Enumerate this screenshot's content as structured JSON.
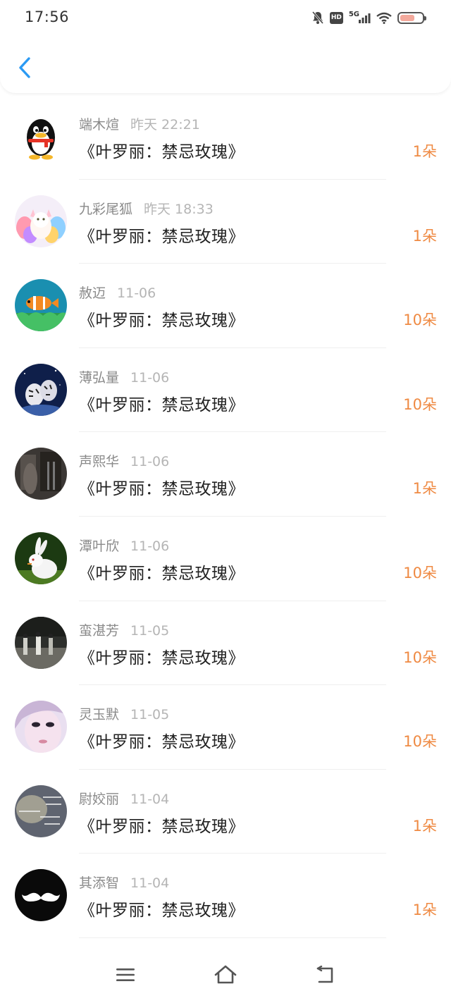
{
  "status_bar": {
    "time": "17:56",
    "network": "5G",
    "hd": "HD"
  },
  "header": {
    "back_icon": "chevron-left-icon",
    "accent_color": "#2b9af3"
  },
  "gifts": [
    {
      "name": "端木煊",
      "time": "昨天 22:21",
      "title": "《叶罗丽：禁忌玫瑰》",
      "amount": "1朵",
      "avatar": "qq-penguin"
    },
    {
      "name": "九彩尾狐",
      "time": "昨天 18:33",
      "title": "《叶罗丽：禁忌玫瑰》",
      "amount": "1朵",
      "avatar": "fox"
    },
    {
      "name": "赦迈",
      "time": "11-06",
      "title": "《叶罗丽：禁忌玫瑰》",
      "amount": "10朵",
      "avatar": "clownfish"
    },
    {
      "name": "薄弘量",
      "time": "11-06",
      "title": "《叶罗丽：禁忌玫瑰》",
      "amount": "10朵",
      "avatar": "tigers"
    },
    {
      "name": "声熙华",
      "time": "11-06",
      "title": "《叶罗丽：禁忌玫瑰》",
      "amount": "1朵",
      "avatar": "dark-photo"
    },
    {
      "name": "潭叶欣",
      "time": "11-06",
      "title": "《叶罗丽：禁忌玫瑰》",
      "amount": "10朵",
      "avatar": "rabbit"
    },
    {
      "name": "蛮湛芳",
      "time": "11-05",
      "title": "《叶罗丽：禁忌玫瑰》",
      "amount": "10朵",
      "avatar": "street-photo"
    },
    {
      "name": "灵玉默",
      "time": "11-05",
      "title": "《叶罗丽：禁忌玫瑰》",
      "amount": "10朵",
      "avatar": "girl-face"
    },
    {
      "name": "尉姣丽",
      "time": "11-04",
      "title": "《叶罗丽：禁忌玫瑰》",
      "amount": "1朵",
      "avatar": "text-image"
    },
    {
      "name": "其添智",
      "time": "11-04",
      "title": "《叶罗丽：禁忌玫瑰》",
      "amount": "1朵",
      "avatar": "mustache"
    }
  ],
  "amount_color": "#ef8a43",
  "bottom_nav": {
    "menu_icon": "menu-icon",
    "home_icon": "home-icon",
    "back_icon": "back-icon"
  }
}
